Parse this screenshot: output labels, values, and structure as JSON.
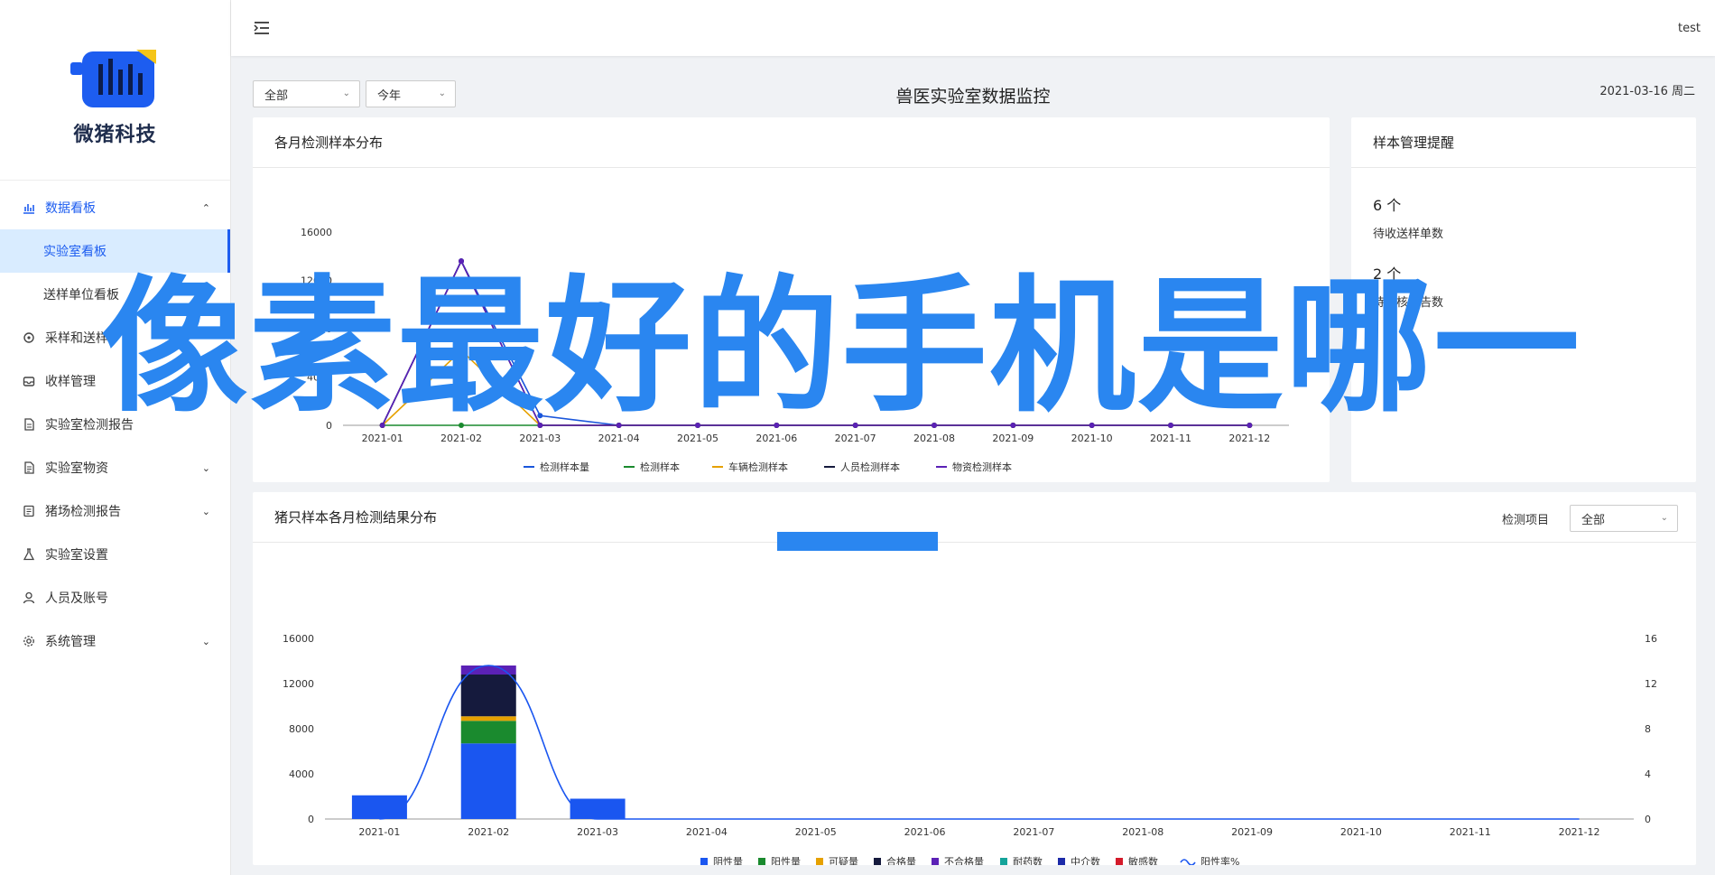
{
  "brand": {
    "name": "微猪科技"
  },
  "sidebar": {
    "items": [
      {
        "label": "数据看板",
        "icon": "bar-chart-icon",
        "open": true,
        "sub": [
          {
            "label": "实验室看板",
            "active": true
          },
          {
            "label": "送样单位看板",
            "active": false
          }
        ]
      },
      {
        "label": "采样和送样",
        "icon": "sampling-icon"
      },
      {
        "label": "收样管理",
        "icon": "inbox-icon"
      },
      {
        "label": "实验室检测报告",
        "icon": "report-icon"
      },
      {
        "label": "实验室物资",
        "icon": "supplies-icon",
        "chevron": true
      },
      {
        "label": "猪场检测报告",
        "icon": "farm-report-icon",
        "chevron": true
      },
      {
        "label": "实验室设置",
        "icon": "flask-icon"
      },
      {
        "label": "人员及账号",
        "icon": "user-icon"
      },
      {
        "label": "系统管理",
        "icon": "gear-icon",
        "chevron": true
      }
    ]
  },
  "header": {
    "user": "test"
  },
  "filters": {
    "scope": "全部",
    "period": "今年",
    "item_label": "检测项目",
    "item_value": "全部"
  },
  "page": {
    "title": "兽医实验室数据监控",
    "date": "2021-03-16 周二"
  },
  "panels": {
    "monthly": {
      "title": "各月检测样本分布"
    },
    "reminder": {
      "title": "样本管理提醒",
      "items": [
        {
          "count": "6 个",
          "label": "待收送样单数"
        },
        {
          "count": "2 个",
          "label": "待审核报告数"
        }
      ]
    },
    "pig": {
      "title": "猪只样本各月检测结果分布"
    }
  },
  "overlay": {
    "text": "像素最好的手机是哪一"
  },
  "colors": {
    "accent": "#1d5df0",
    "overlay": "#2a86f0"
  },
  "chart_data": [
    {
      "type": "line",
      "categories": [
        "2021-01",
        "2021-02",
        "2021-03",
        "2021-04",
        "2021-05",
        "2021-06",
        "2021-07",
        "2021-08",
        "2021-09",
        "2021-10",
        "2021-11",
        "2021-12"
      ],
      "ylim": [
        0,
        16000
      ],
      "yticks": [
        "16000",
        "12000",
        "8000",
        "4000",
        "0"
      ],
      "series": [
        {
          "name": "检测样本量",
          "color": "#1a56db",
          "values": [
            0,
            13600,
            800,
            0,
            0,
            0,
            0,
            0,
            0,
            0,
            0,
            0
          ]
        },
        {
          "name": "检测样本",
          "color": "#1a8a2e",
          "values": [
            0,
            0,
            0,
            0,
            0,
            0,
            0,
            0,
            0,
            0,
            0,
            0
          ]
        },
        {
          "name": "车辆检测样本",
          "color": "#e6a100",
          "values": [
            0,
            6200,
            0,
            0,
            0,
            0,
            0,
            0,
            0,
            0,
            0,
            0
          ]
        },
        {
          "name": "人员检测样本",
          "color": "#151a3d",
          "values": [
            0,
            13600,
            0,
            0,
            0,
            0,
            0,
            0,
            0,
            0,
            0,
            0
          ]
        },
        {
          "name": "物资检测样本",
          "color": "#5b21b6",
          "values": [
            0,
            13600,
            0,
            0,
            0,
            0,
            0,
            0,
            0,
            0,
            0,
            0
          ]
        }
      ]
    },
    {
      "type": "bar",
      "categories": [
        "2021-01",
        "2021-02",
        "2021-03",
        "2021-04",
        "2021-05",
        "2021-06",
        "2021-07",
        "2021-08",
        "2021-09",
        "2021-10",
        "2021-11",
        "2021-12"
      ],
      "ylim": [
        0,
        16000
      ],
      "yticks": [
        "16000",
        "12000",
        "8000",
        "4000",
        "0"
      ],
      "y2lim": [
        0,
        16
      ],
      "y2ticks": [
        "16",
        "12",
        "8",
        "4",
        "0"
      ],
      "series": [
        {
          "name": "阴性量",
          "color": "#1a56f0",
          "values": [
            2100,
            6700,
            1800,
            0,
            0,
            0,
            0,
            0,
            0,
            0,
            0,
            0
          ]
        },
        {
          "name": "阳性量",
          "color": "#1a8a2e",
          "values": [
            0,
            2000,
            0,
            0,
            0,
            0,
            0,
            0,
            0,
            0,
            0,
            0
          ]
        },
        {
          "name": "可疑量",
          "color": "#e6a100",
          "values": [
            0,
            400,
            0,
            0,
            0,
            0,
            0,
            0,
            0,
            0,
            0,
            0
          ]
        },
        {
          "name": "合格量",
          "color": "#151a3d",
          "values": [
            0,
            3700,
            0,
            0,
            0,
            0,
            0,
            0,
            0,
            0,
            0,
            0
          ]
        },
        {
          "name": "不合格量",
          "color": "#5b21b6",
          "values": [
            0,
            800,
            0,
            0,
            0,
            0,
            0,
            0,
            0,
            0,
            0,
            0
          ]
        },
        {
          "name": "耐药数",
          "color": "#14a39a",
          "values": [
            0,
            0,
            0,
            0,
            0,
            0,
            0,
            0,
            0,
            0,
            0,
            0
          ]
        },
        {
          "name": "中介数",
          "color": "#1c2aa8",
          "values": [
            0,
            0,
            0,
            0,
            0,
            0,
            0,
            0,
            0,
            0,
            0,
            0
          ]
        },
        {
          "name": "敏感数",
          "color": "#d41a2a",
          "values": [
            0,
            0,
            0,
            0,
            0,
            0,
            0,
            0,
            0,
            0,
            0,
            0
          ]
        }
      ],
      "line": {
        "name": "阳性率%",
        "color": "#1a56f0",
        "values": [
          0,
          13.6,
          0,
          0,
          0,
          0,
          0,
          0,
          0,
          0,
          0,
          0
        ]
      }
    }
  ]
}
